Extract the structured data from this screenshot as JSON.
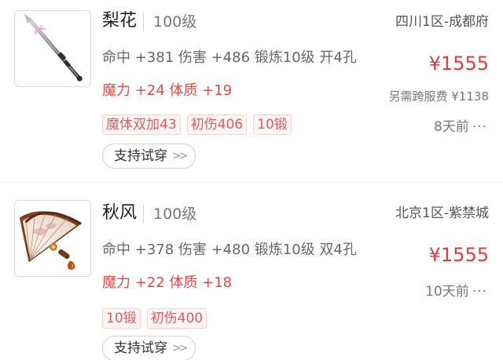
{
  "listings": [
    {
      "icon": "spear-weapon-icon",
      "name": "梨花",
      "level": "100级",
      "server": "四川1区-成都府",
      "stats": "命中 +381 伤害 +486 锻炼10级 开4孔",
      "price": "¥1555",
      "attrs": "魔力 +24 体质 +19",
      "extra_fee": "另需跨服费 ¥1138",
      "tags": [
        "魔体双加43",
        "初伤406",
        "10锻"
      ],
      "time": "8天前",
      "try_label": "支持试穿"
    },
    {
      "icon": "fan-weapon-icon",
      "name": "秋风",
      "level": "100级",
      "server": "北京1区-紫禁城",
      "stats": "命中 +378 伤害 +480 锻炼10级 双4孔",
      "price": "¥1555",
      "attrs": "魔力 +22 体质 +18",
      "extra_fee": "",
      "tags": [
        "10锻",
        "初伤400"
      ],
      "time": "10天前",
      "try_label": "支持试穿"
    }
  ],
  "colors": {
    "price": "#e03c3c",
    "attrs": "#e04a48",
    "tag_text": "#e05d5b",
    "tag_bg": "#fff5f4"
  },
  "icons": {
    "more": "ellipsis-icon",
    "chevron": "double-chevron-right-icon"
  }
}
